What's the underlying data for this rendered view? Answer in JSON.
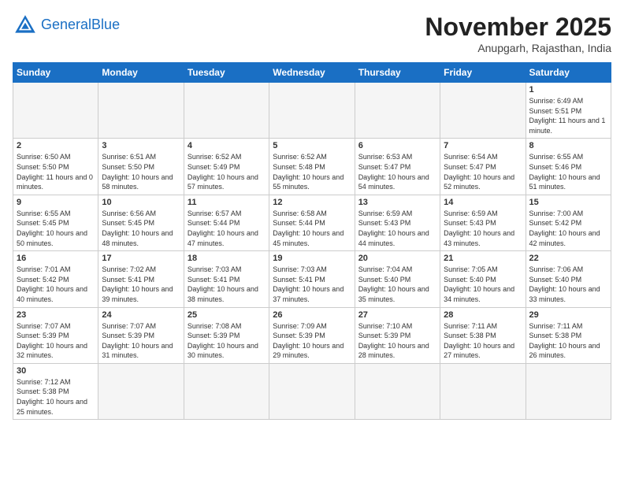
{
  "header": {
    "logo_general": "General",
    "logo_blue": "Blue",
    "month_title": "November 2025",
    "subtitle": "Anupgarh, Rajasthan, India"
  },
  "weekdays": [
    "Sunday",
    "Monday",
    "Tuesday",
    "Wednesday",
    "Thursday",
    "Friday",
    "Saturday"
  ],
  "weeks": [
    [
      {
        "day": "",
        "empty": true
      },
      {
        "day": "",
        "empty": true
      },
      {
        "day": "",
        "empty": true
      },
      {
        "day": "",
        "empty": true
      },
      {
        "day": "",
        "empty": true
      },
      {
        "day": "",
        "empty": true
      },
      {
        "day": "1",
        "sunrise": "6:49 AM",
        "sunset": "5:51 PM",
        "daylight": "11 hours and 1 minute."
      }
    ],
    [
      {
        "day": "2",
        "sunrise": "6:50 AM",
        "sunset": "5:50 PM",
        "daylight": "11 hours and 0 minutes."
      },
      {
        "day": "3",
        "sunrise": "6:51 AM",
        "sunset": "5:50 PM",
        "daylight": "10 hours and 58 minutes."
      },
      {
        "day": "4",
        "sunrise": "6:52 AM",
        "sunset": "5:49 PM",
        "daylight": "10 hours and 57 minutes."
      },
      {
        "day": "5",
        "sunrise": "6:52 AM",
        "sunset": "5:48 PM",
        "daylight": "10 hours and 55 minutes."
      },
      {
        "day": "6",
        "sunrise": "6:53 AM",
        "sunset": "5:47 PM",
        "daylight": "10 hours and 54 minutes."
      },
      {
        "day": "7",
        "sunrise": "6:54 AM",
        "sunset": "5:47 PM",
        "daylight": "10 hours and 52 minutes."
      },
      {
        "day": "8",
        "sunrise": "6:55 AM",
        "sunset": "5:46 PM",
        "daylight": "10 hours and 51 minutes."
      }
    ],
    [
      {
        "day": "9",
        "sunrise": "6:55 AM",
        "sunset": "5:45 PM",
        "daylight": "10 hours and 50 minutes."
      },
      {
        "day": "10",
        "sunrise": "6:56 AM",
        "sunset": "5:45 PM",
        "daylight": "10 hours and 48 minutes."
      },
      {
        "day": "11",
        "sunrise": "6:57 AM",
        "sunset": "5:44 PM",
        "daylight": "10 hours and 47 minutes."
      },
      {
        "day": "12",
        "sunrise": "6:58 AM",
        "sunset": "5:44 PM",
        "daylight": "10 hours and 45 minutes."
      },
      {
        "day": "13",
        "sunrise": "6:59 AM",
        "sunset": "5:43 PM",
        "daylight": "10 hours and 44 minutes."
      },
      {
        "day": "14",
        "sunrise": "6:59 AM",
        "sunset": "5:43 PM",
        "daylight": "10 hours and 43 minutes."
      },
      {
        "day": "15",
        "sunrise": "7:00 AM",
        "sunset": "5:42 PM",
        "daylight": "10 hours and 42 minutes."
      }
    ],
    [
      {
        "day": "16",
        "sunrise": "7:01 AM",
        "sunset": "5:42 PM",
        "daylight": "10 hours and 40 minutes."
      },
      {
        "day": "17",
        "sunrise": "7:02 AM",
        "sunset": "5:41 PM",
        "daylight": "10 hours and 39 minutes."
      },
      {
        "day": "18",
        "sunrise": "7:03 AM",
        "sunset": "5:41 PM",
        "daylight": "10 hours and 38 minutes."
      },
      {
        "day": "19",
        "sunrise": "7:03 AM",
        "sunset": "5:41 PM",
        "daylight": "10 hours and 37 minutes."
      },
      {
        "day": "20",
        "sunrise": "7:04 AM",
        "sunset": "5:40 PM",
        "daylight": "10 hours and 35 minutes."
      },
      {
        "day": "21",
        "sunrise": "7:05 AM",
        "sunset": "5:40 PM",
        "daylight": "10 hours and 34 minutes."
      },
      {
        "day": "22",
        "sunrise": "7:06 AM",
        "sunset": "5:40 PM",
        "daylight": "10 hours and 33 minutes."
      }
    ],
    [
      {
        "day": "23",
        "sunrise": "7:07 AM",
        "sunset": "5:39 PM",
        "daylight": "10 hours and 32 minutes."
      },
      {
        "day": "24",
        "sunrise": "7:07 AM",
        "sunset": "5:39 PM",
        "daylight": "10 hours and 31 minutes."
      },
      {
        "day": "25",
        "sunrise": "7:08 AM",
        "sunset": "5:39 PM",
        "daylight": "10 hours and 30 minutes."
      },
      {
        "day": "26",
        "sunrise": "7:09 AM",
        "sunset": "5:39 PM",
        "daylight": "10 hours and 29 minutes."
      },
      {
        "day": "27",
        "sunrise": "7:10 AM",
        "sunset": "5:39 PM",
        "daylight": "10 hours and 28 minutes."
      },
      {
        "day": "28",
        "sunrise": "7:11 AM",
        "sunset": "5:38 PM",
        "daylight": "10 hours and 27 minutes."
      },
      {
        "day": "29",
        "sunrise": "7:11 AM",
        "sunset": "5:38 PM",
        "daylight": "10 hours and 26 minutes."
      }
    ],
    [
      {
        "day": "30",
        "sunrise": "7:12 AM",
        "sunset": "5:38 PM",
        "daylight": "10 hours and 25 minutes."
      },
      {
        "day": "",
        "empty": true
      },
      {
        "day": "",
        "empty": true
      },
      {
        "day": "",
        "empty": true
      },
      {
        "day": "",
        "empty": true
      },
      {
        "day": "",
        "empty": true
      },
      {
        "day": "",
        "empty": true
      }
    ]
  ]
}
